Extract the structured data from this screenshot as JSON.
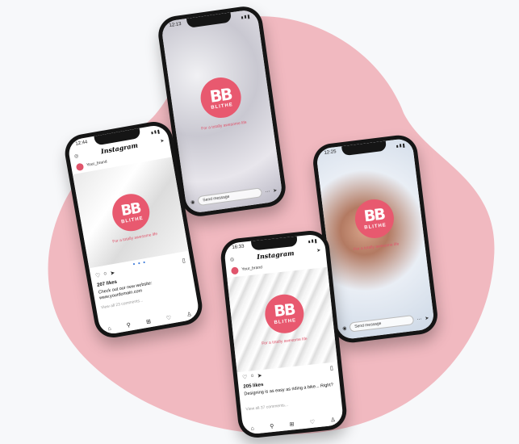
{
  "brand": {
    "mark": "BB",
    "word": "BLITHE",
    "tagline": "For a totally awesome life",
    "color": "#e8596f",
    "blob_color": "#f1b9c0"
  },
  "phone_left": {
    "time": "12:44",
    "app_name": "Instagram",
    "account": "Your_brand",
    "likes": "207 likes",
    "caption": "Check out our new website: www.yourdomain.com",
    "comments": "View all 23 comments..."
  },
  "phone_top": {
    "time": "12:13",
    "message_placeholder": "Send message"
  },
  "phone_right": {
    "time": "12:25",
    "message_placeholder": "Send message"
  },
  "phone_bottom": {
    "time": "16:33",
    "app_name": "Instagram",
    "account": "Your_brand",
    "likes": "205 likes",
    "caption": "Designing is as easy as riding a bike... Right?",
    "comments": "View all 37 comments..."
  }
}
